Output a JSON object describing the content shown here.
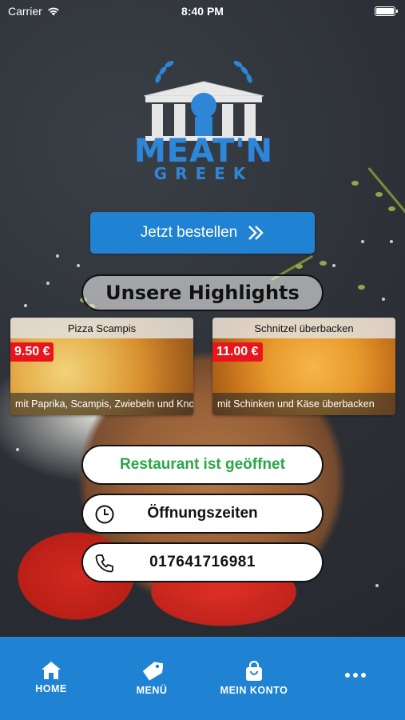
{
  "status_bar": {
    "carrier": "Carrier",
    "time": "8:40 PM",
    "battery_level": 1.0
  },
  "logo": {
    "line1": "MEAT'N",
    "line2": "GREEK"
  },
  "order_button": {
    "label": "Jetzt bestellen"
  },
  "highlights": {
    "title": "Unsere Highlights",
    "items": [
      {
        "name": "Pizza Scampis",
        "price": "9.50 €",
        "description": "mit Paprika, Scampis, Zwiebeln und Kno..."
      },
      {
        "name": "Schnitzel überbacken",
        "price": "11.00 €",
        "description": "mit Schinken und Käse überbacken"
      }
    ]
  },
  "info": {
    "open_status": "Restaurant ist geöffnet",
    "hours_label": "Öffnungszeiten",
    "phone": "017641716981"
  },
  "tabbar": {
    "items": [
      {
        "label": "HOME",
        "icon": "home-icon"
      },
      {
        "label": "MENÜ",
        "icon": "tag-icon"
      },
      {
        "label": "MEIN KONTO",
        "icon": "shopping-bag-icon"
      },
      {
        "label": "",
        "icon": "more-icon"
      }
    ]
  },
  "colors": {
    "brand_blue": "#1f82d2",
    "price_red": "#e8161c",
    "open_green": "#27a745"
  }
}
